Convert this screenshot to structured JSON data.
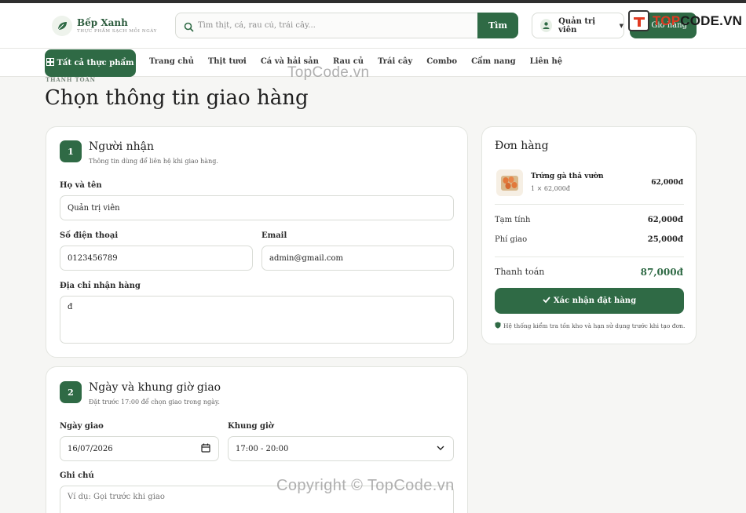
{
  "brand": {
    "name": "Bếp Xanh",
    "tagline": "THỰC PHẨM SẠCH MỖI NGÀY"
  },
  "search": {
    "placeholder": "Tìm thịt, cá, rau củ, trái cây...",
    "button": "Tìm"
  },
  "account": {
    "label": "Quản trị viên"
  },
  "cart": {
    "label": "Giỏ hàng"
  },
  "watermark": {
    "logo_left": "T",
    "logo_accent": "OP",
    "logo_rest": "CODE.VN",
    "text": "TopCode.vn",
    "copyright": "Copyright © TopCode.vn"
  },
  "nav": {
    "all_label": "Tất cả thực phẩm",
    "links": [
      "Trang chủ",
      "Thịt tươi",
      "Cá và hải sản",
      "Rau củ",
      "Trái cây",
      "Combo",
      "Cẩm nang",
      "Liên hệ"
    ]
  },
  "breadcrumb": "THANH TOÁN",
  "page_title": "Chọn thông tin giao hàng",
  "recipient": {
    "step": "1",
    "title": "Người nhận",
    "subtitle": "Thông tin dùng để liên hệ khi giao hàng.",
    "name_label": "Họ và tên",
    "name_value": "Quản trị viên",
    "phone_label": "Số điện thoại",
    "phone_value": "0123456789",
    "email_label": "Email",
    "email_value": "admin@gmail.com",
    "address_label": "Địa chỉ nhận hàng",
    "address_value": "đ"
  },
  "delivery": {
    "step": "2",
    "title": "Ngày và khung giờ giao",
    "subtitle": "Đặt trước 17:00 để chọn giao trong ngày.",
    "date_label": "Ngày giao",
    "date_value": "16/07/2026",
    "slot_label": "Khung giờ",
    "slot_value": "17:00 - 20:00",
    "note_label": "Ghi chú",
    "note_placeholder": "Ví dụ: Gọi trước khi giao"
  },
  "order": {
    "title": "Đơn hàng",
    "item_name": "Trứng gà thả vườn",
    "item_qty": "1 × 62,000đ",
    "item_price": "62,000đ",
    "subtotal_label": "Tạm tính",
    "subtotal_value": "62,000đ",
    "shipping_label": "Phí giao",
    "shipping_value": "25,000đ",
    "total_label": "Thanh toán",
    "total_value": "87,000đ",
    "confirm_label": "Xác nhận đặt hàng",
    "note": "Hệ thống kiểm tra tồn kho và hạn sử dụng trước khi tạo đơn."
  },
  "colors": {
    "primary": "#2f6a45",
    "accent": "#e03a22"
  }
}
